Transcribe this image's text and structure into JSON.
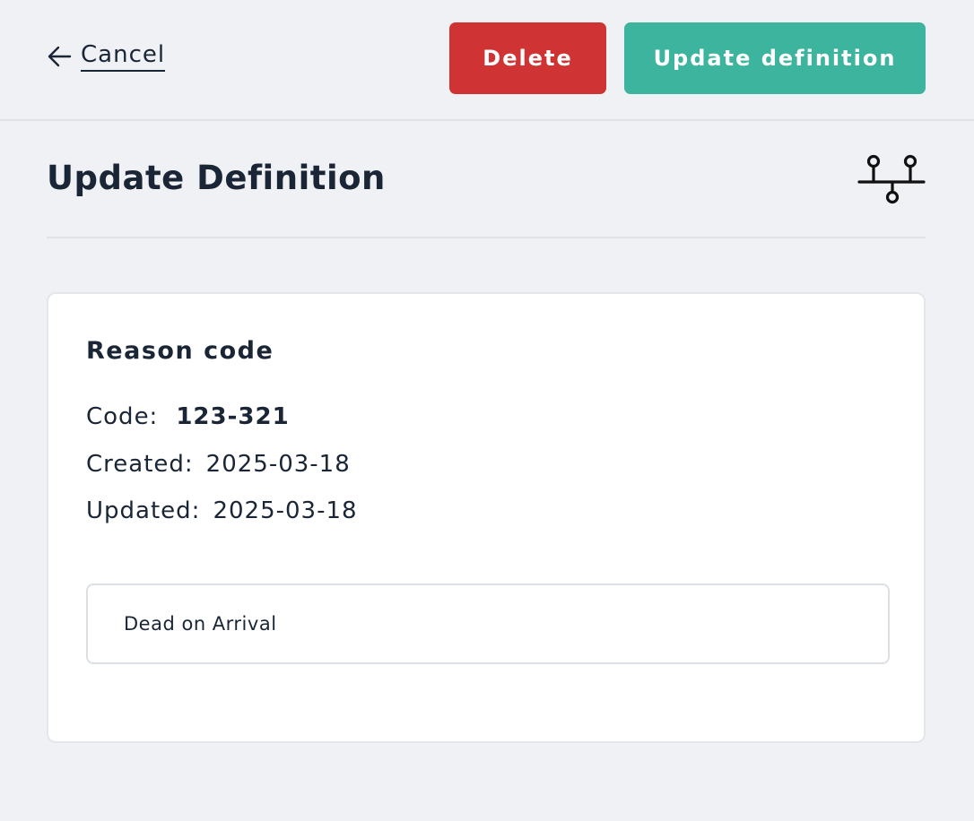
{
  "toolbar": {
    "cancel_label": "Cancel",
    "delete_label": "Delete",
    "update_label": "Update definition",
    "delete_color": "#d03333",
    "update_color": "#3db59e"
  },
  "header": {
    "title": "Update Definition",
    "icon": "structure-icon"
  },
  "card": {
    "title": "Reason code",
    "code_label": "Code:",
    "code_value": "123-321",
    "created_label": "Created:",
    "created_value": "2025-03-18",
    "updated_label": "Updated:",
    "updated_value": "2025-03-18",
    "description": "Dead on Arrival"
  }
}
